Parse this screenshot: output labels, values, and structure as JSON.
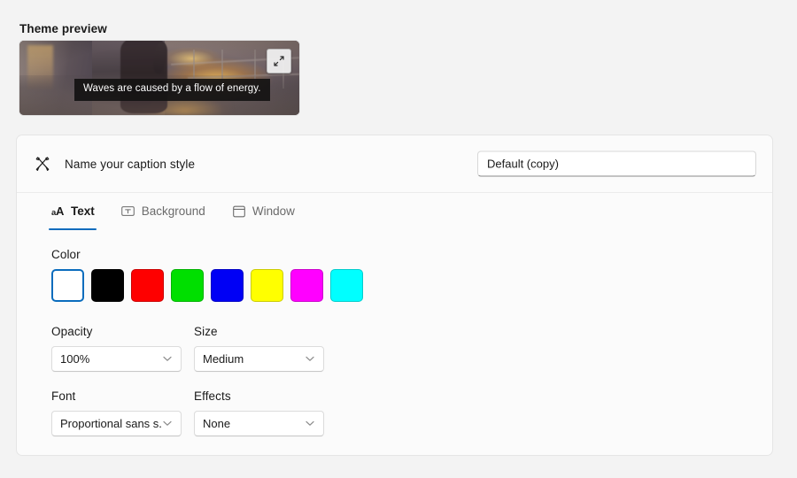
{
  "preview": {
    "label": "Theme preview",
    "caption_text": "Waves are caused by a flow of energy.",
    "expand_icon": "expand-diagonal-arrows-icon"
  },
  "card": {
    "header": {
      "icon": "crossed-pen-brush-icon",
      "title": "Name your caption style",
      "style_name_value": "Default (copy)",
      "style_name_placeholder": "Name your caption style"
    },
    "tabs": [
      {
        "label": "Text",
        "icon": "aA-text-icon",
        "active": true
      },
      {
        "label": "Background",
        "icon": "text-in-box-icon",
        "active": false
      },
      {
        "label": "Window",
        "icon": "window-frame-icon",
        "active": false
      }
    ],
    "color_section": {
      "label": "Color",
      "selected_index": 0,
      "swatches": [
        {
          "name": "white",
          "hex": "#ffffff"
        },
        {
          "name": "black",
          "hex": "#000000"
        },
        {
          "name": "red",
          "hex": "#fe0000"
        },
        {
          "name": "green",
          "hex": "#00df00"
        },
        {
          "name": "blue",
          "hex": "#0000f5"
        },
        {
          "name": "yellow",
          "hex": "#ffff00"
        },
        {
          "name": "magenta",
          "hex": "#ff00ff"
        },
        {
          "name": "cyan",
          "hex": "#00ffff"
        }
      ]
    },
    "fields": {
      "opacity": {
        "label": "Opacity",
        "value": "100%"
      },
      "size": {
        "label": "Size",
        "value": "Medium"
      },
      "font": {
        "label": "Font",
        "value": "Proportional sans s..."
      },
      "effects": {
        "label": "Effects",
        "value": "None"
      }
    }
  },
  "colors": {
    "accent": "#0f6cbd",
    "selection_border": "#0a6cbd",
    "page_background": "#f3f3f3",
    "card_background": "#fbfbfb"
  }
}
